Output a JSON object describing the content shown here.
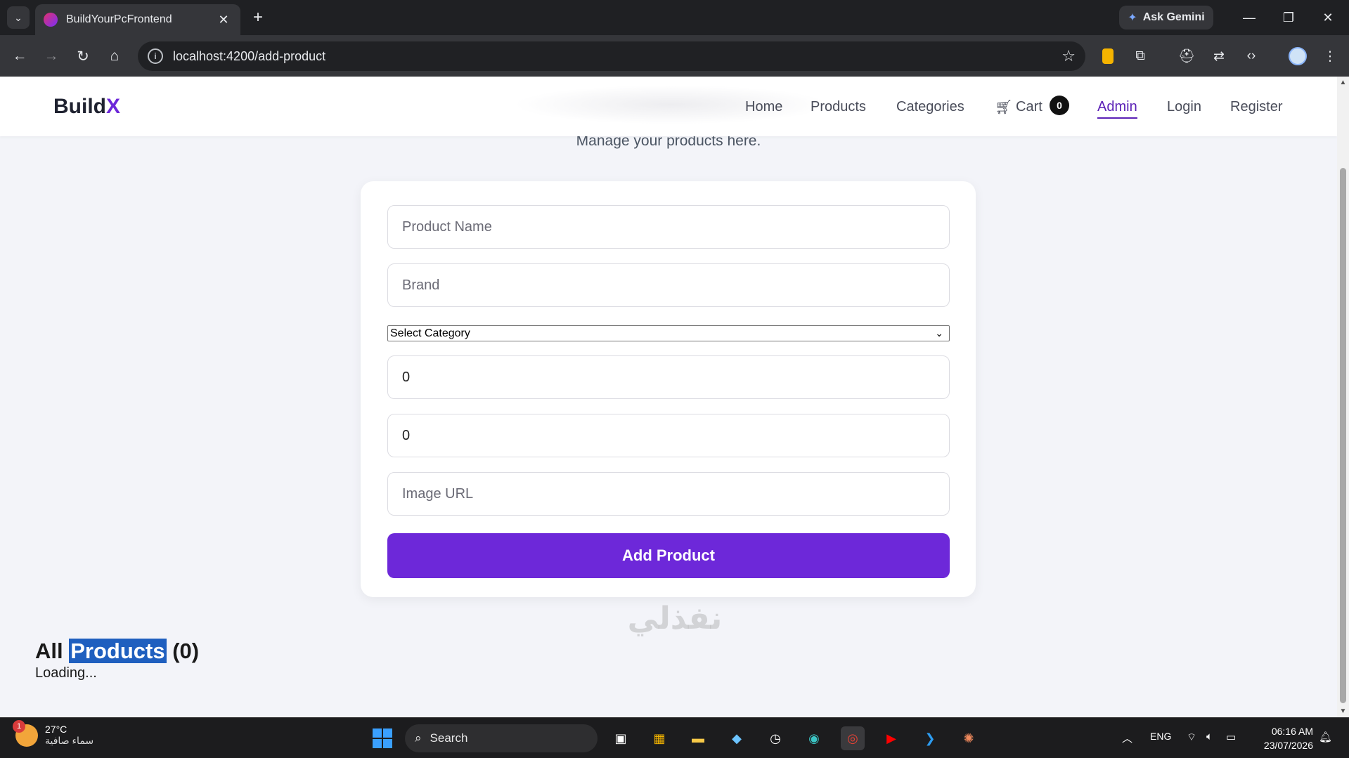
{
  "browser": {
    "tab_title": "BuildYourPcFrontend",
    "url": "localhost:4200/add-product",
    "gemini_label": "Ask Gemini"
  },
  "site": {
    "logo_main": "Build",
    "logo_accent": "X",
    "nav": {
      "home": "Home",
      "products": "Products",
      "categories": "Categories",
      "cart": "Cart",
      "cart_count": "0",
      "admin": "Admin",
      "login": "Login",
      "register": "Register"
    },
    "subtitle": "Manage your products here."
  },
  "form": {
    "product_name_placeholder": "Product Name",
    "brand_placeholder": "Brand",
    "category_selected": "Select Category",
    "price_value": "0",
    "stock_value": "0",
    "image_url_placeholder": "Image URL",
    "submit_label": "Add Product"
  },
  "products": {
    "title_prefix": "All",
    "title_highlight": "Products",
    "title_count": "(0)",
    "loading": "Loading..."
  },
  "taskbar": {
    "temp": "27°C",
    "condition": "سماء صافية",
    "weather_alert": "1",
    "search": "Search",
    "language": "ENG",
    "time": "06:16 AM",
    "date": "23/07/2026"
  },
  "watermark": "نفذلي",
  "colors": {
    "accent": "#6d28d9",
    "nav_active": "#5b21b6",
    "selection": "#1f5fbf"
  }
}
